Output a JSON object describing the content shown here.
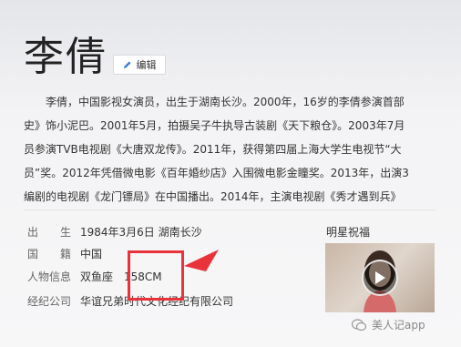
{
  "person": {
    "name": "李倩",
    "edit_label": "编辑"
  },
  "summary": {
    "lines": [
      "　　李倩，中国影视女演员，出生于湖南长沙。2000年，16岁的李倩参演首部",
      "史》饰小泥巴。2001年5月，拍摄吴子牛执导古装剧《天下粮仓》。2003年7月",
      "员参演TVB电视剧《大唐双龙传》。2011年，获得第四届上海大学生电视节“大",
      "员”奖。2012年凭借微电影《百年婚纱店》入围微电影金瞳奖。2013年，出演3",
      "编剧的电视剧《龙门镖局》在中国播出。2014年，主演电视剧《秀才遇到兵》"
    ]
  },
  "info": {
    "rows": [
      {
        "key": "出　　生",
        "value": "1984年3月6日 湖南长沙"
      },
      {
        "key": "国　　籍",
        "value": "中国"
      },
      {
        "key": "人物信息",
        "value": "双鱼座　158CM"
      },
      {
        "key": "经纪公司",
        "value": "华谊兄弟时代文化经纪有限公司"
      }
    ]
  },
  "fans": {
    "title": "明星祝福"
  },
  "watermark": {
    "text": "美人记app"
  },
  "colors": {
    "annotation": "#e8333a",
    "play_overlay": "#000000"
  }
}
